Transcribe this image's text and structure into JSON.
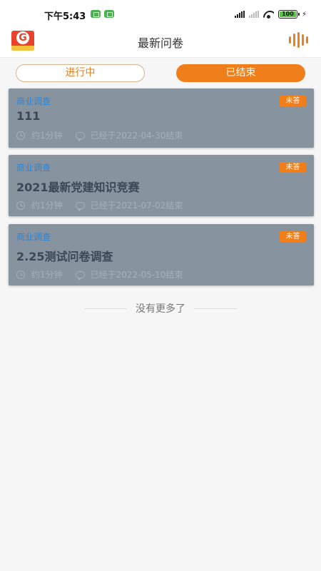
{
  "status_bar": {
    "time": "下午5:43",
    "battery": "100"
  },
  "header": {
    "title": "最新问卷"
  },
  "tabs": [
    {
      "label": "进行中",
      "active": false
    },
    {
      "label": "已结束",
      "active": true
    }
  ],
  "surveys": [
    {
      "category": "商业调查",
      "title": "111",
      "badge": "未答",
      "duration": "约1分钟",
      "ended": "已经于2022-04-30结束"
    },
    {
      "category": "商业调查",
      "title": "2021最新党建知识竞赛",
      "badge": "未答",
      "duration": "约1分钟",
      "ended": "已经于2021-07-02结束"
    },
    {
      "category": "商业调查",
      "title": "2.25测试问卷调查",
      "badge": "未答",
      "duration": "约1分钟",
      "ended": "已经于2022-05-10结束"
    }
  ],
  "footer": {
    "no_more": "没有更多了"
  },
  "colors": {
    "accent": "#f07e1a",
    "card_overlay": "#8794a0",
    "category_text": "#2a84d6"
  },
  "icons": [
    "app-logo-icon",
    "voice-wave-icon",
    "clock-icon",
    "chat-bubble-icon",
    "signal-icon",
    "wifi-icon",
    "battery-icon",
    "charging-icon"
  ]
}
